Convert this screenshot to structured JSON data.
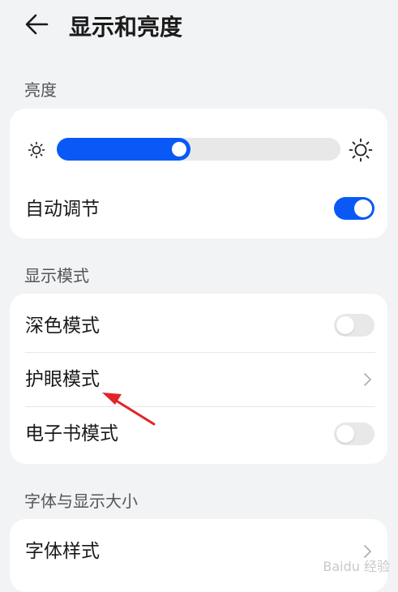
{
  "header": {
    "title": "显示和亮度",
    "back_icon": "arrow-left-icon"
  },
  "brightness": {
    "section_label": "亮度",
    "level_fraction": 0.47,
    "low_icon": "sun-small-icon",
    "high_icon": "sun-large-icon",
    "auto_label": "自动调节",
    "auto_enabled": true
  },
  "display_mode": {
    "section_label": "显示模式",
    "items": [
      {
        "label": "深色模式",
        "control": "toggle",
        "enabled": false
      },
      {
        "label": "护眼模式",
        "control": "chevron"
      },
      {
        "label": "电子书模式",
        "control": "toggle",
        "enabled": false
      }
    ]
  },
  "font_size": {
    "section_label": "字体与显示大小",
    "items": [
      {
        "label": "字体样式",
        "control": "chevron"
      }
    ]
  },
  "watermark": "Baidu 经验",
  "colors": {
    "accent": "#0a59f7",
    "background": "#f1f3f5",
    "card": "#ffffff",
    "annotation_arrow": "#e0242b"
  }
}
